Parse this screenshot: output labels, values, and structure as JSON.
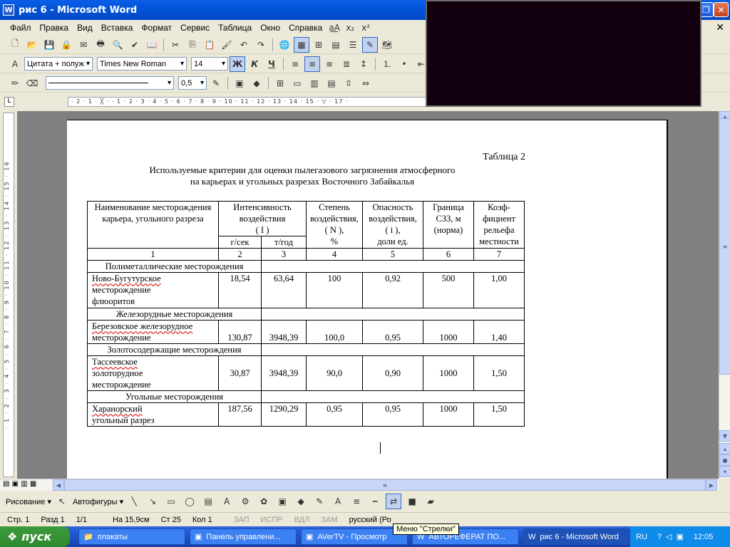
{
  "window": {
    "title": "рис 6 - Microsoft Word"
  },
  "menu": [
    "Файл",
    "Правка",
    "Вид",
    "Вставка",
    "Формат",
    "Сервис",
    "Таблица",
    "Окно",
    "Справка"
  ],
  "formatting": {
    "style": "Цитата + полуж",
    "font": "Times New Roman",
    "size": "14",
    "line_width": "0,5"
  },
  "ruler": {
    "h": "· 2 · 1 · ╳ · · 1 · 2 · 3 · 4 · 5 · 6 · 7 · 8 · 9 · 10 · 11 · 12 · 13 · 14 · 15 · ▽ · 17 ·",
    "v": "· 1 · 2 · 3 · 4 · 5 · 6 · 7 · 8 · 9 · 10 · 11 · 12 · 13 · 14 · 15 · 16"
  },
  "document": {
    "table_number": "Таблица 2",
    "title_line1": "Используемые критерии  для оценки пылегазового  загрязнения атмосферного",
    "title_line2": "на карьерах и угольных  разрезах    Восточного Забайкалья",
    "headers": {
      "h1": "Наименование месторождения карьера, угольного разреза",
      "h2": "Интенсивность воздействия",
      "h2b": "( I )",
      "h3": "Степень воздействия,",
      "h3b": "( N ),",
      "h3c": "%",
      "h4": "Опасность воздействия,",
      "h4b": "( i ),",
      "h4c": "доли ед.",
      "h5": "Граница СЗЗ, м (норма)",
      "h6": "Коэф-фициент рельефа местности",
      "sub1": "г/сек",
      "sub2": "т/год"
    },
    "numbers": [
      "1",
      "2",
      "3",
      "4",
      "5",
      "6",
      "7"
    ],
    "groups": [
      {
        "name": "Полиметаллические  месторождения",
        "row": [
          "Ново-Бугутурское",
          "месторождение",
          "флюоритов",
          "18,54",
          "63,64",
          "100",
          "0,92",
          "500",
          "1,00"
        ]
      },
      {
        "name": "Железорудные месторождения",
        "row": [
          "Березовское железорудное",
          "месторождение",
          "",
          "130,87",
          "3948,39",
          "100,0",
          "0,95",
          "1000",
          "1,40"
        ]
      },
      {
        "name": "Золотосодержащие  месторождения",
        "row": [
          "Тассеевское",
          "золоторудное",
          "месторождение",
          "30,87",
          "3948,39",
          "90,0",
          "0,90",
          "1000",
          "1,50"
        ]
      },
      {
        "name": "Угольные месторождения",
        "row": [
          "Харанорский",
          "угольный разрез",
          "",
          "187,56",
          "1290,29",
          "0,95",
          "0,95",
          "1000",
          "1,50"
        ]
      }
    ]
  },
  "drawing_bar": {
    "draw": "Рисование ▾",
    "autoshapes": "Автофигуры ▾"
  },
  "status": {
    "page": "Стр.   1",
    "section": "Разд  1",
    "pages": "1/1",
    "at": "На 15,9см",
    "line": "Ст  25",
    "col": "Кол  1",
    "rec": "ЗАП",
    "trk": "ИСПР",
    "ext": "ВДЛ",
    "ovr": "ЗАМ",
    "lang": "русский (Ро"
  },
  "tooltip": "Меню \"Стрелки\"",
  "taskbar": {
    "start": "пуск",
    "tasks": [
      "плакаты",
      "Панель управлени...",
      "AVerTV - Просмотр",
      "АВТОРЕФЕРАТ ПО...",
      "рис 6 - Microsoft Word"
    ],
    "lang": "RU",
    "clock": "12:05"
  }
}
